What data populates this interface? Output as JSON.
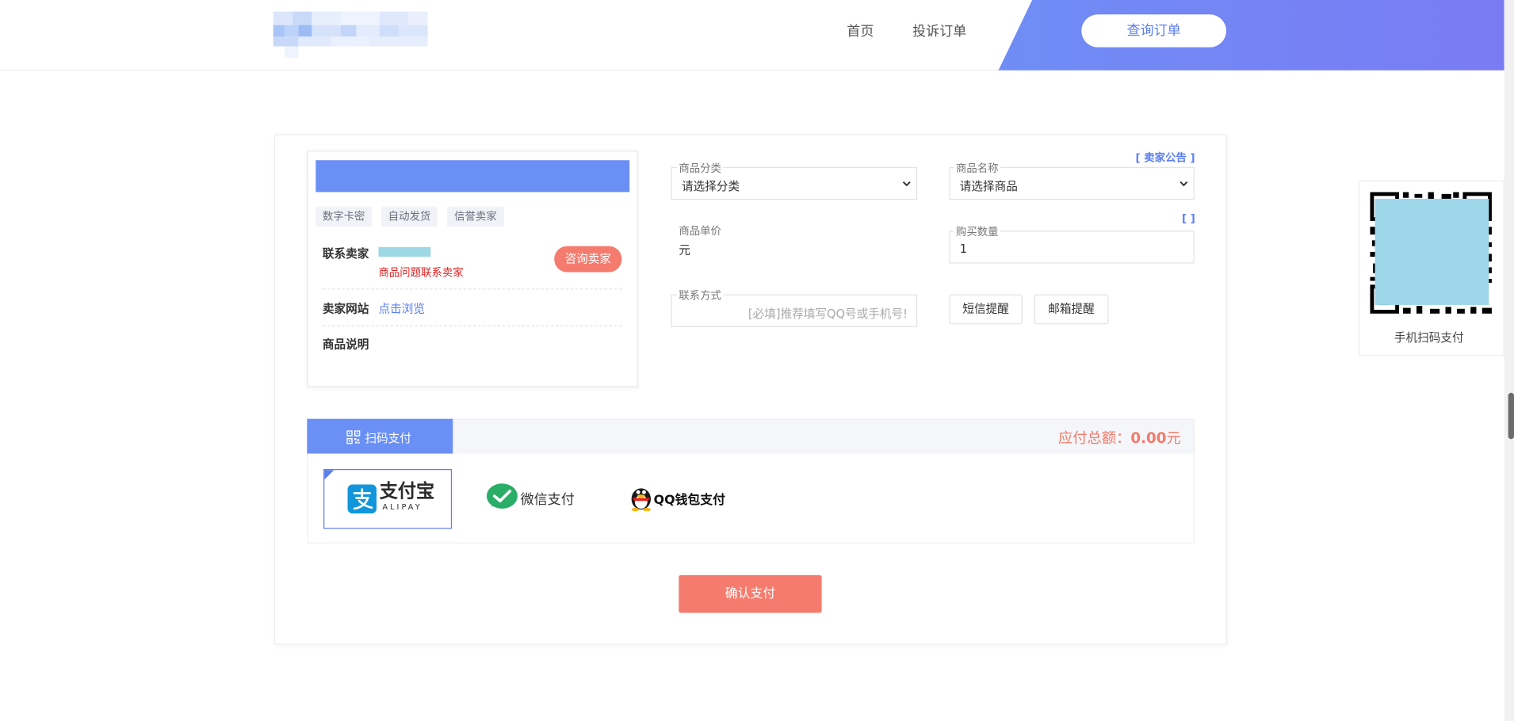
{
  "header": {
    "nav": [
      "首页",
      "投诉订单"
    ],
    "query_button": "查询订单",
    "colors": {
      "accent": "#6f8df5",
      "band_end": "#7a7bf3"
    }
  },
  "seller": {
    "tags": [
      "数字卡密",
      "自动发货",
      "信誉卖家"
    ],
    "contact_label": "联系卖家",
    "contact_note": "商品问题联系卖家",
    "consult_button": "咨询卖家",
    "website_label": "卖家网站",
    "website_link": "点击浏览",
    "desc_label": "商品说明"
  },
  "form": {
    "notice_link": "[ 卖家公告 ]",
    "category": {
      "label": "商品分类",
      "value": "请选择分类"
    },
    "product": {
      "label": "商品名称",
      "value": "请选择商品"
    },
    "price": {
      "label": "商品单价",
      "value": "元"
    },
    "stock_badge": "[ ]",
    "quantity": {
      "label": "购买数量",
      "value": "1"
    },
    "contact": {
      "label": "联系方式",
      "placeholder": "[必填]推荐填写QQ号或手机号!"
    },
    "sms_button": "短信提醒",
    "email_button": "邮箱提醒"
  },
  "payment": {
    "tab_label": "扫码支付",
    "total_label": "应付总额：",
    "total_value": "0.00",
    "total_unit": "元",
    "methods": [
      {
        "name": "支付宝",
        "sub": "ALIPAY",
        "selected": true
      },
      {
        "name": "微信支付",
        "selected": false
      },
      {
        "name": "QQ钱包支付",
        "selected": false
      }
    ],
    "confirm_button": "确认支付",
    "colors": {
      "tab": "#6a8ff5",
      "total": "#f07b6a",
      "confirm": "#f47b6d",
      "alipay": "#1296db",
      "wechat": "#2aae67"
    }
  },
  "qr": {
    "caption": "手机扫码支付"
  }
}
